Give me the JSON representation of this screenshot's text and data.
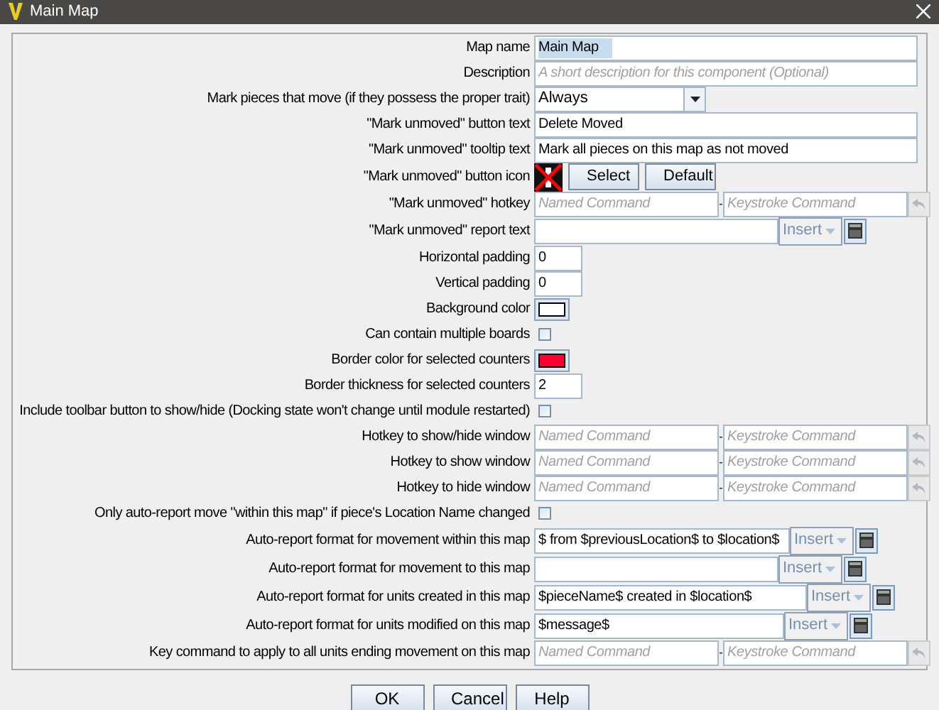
{
  "window": {
    "title": "Main Map"
  },
  "rows": [
    {
      "kind": "text",
      "label": "Map name",
      "value": "Main Map",
      "highlighted": true
    },
    {
      "kind": "text",
      "label": "Description",
      "placeholder": "A short description for this component (Optional)"
    },
    {
      "kind": "dropdown",
      "label": "Mark pieces that move (if they possess the proper trait)",
      "value": "Always"
    },
    {
      "kind": "text",
      "label": "\"Mark unmoved\" button text",
      "value": "Delete Moved"
    },
    {
      "kind": "text",
      "label": "\"Mark unmoved\" tooltip text",
      "value": "Mark all pieces on this map as not moved"
    },
    {
      "kind": "icon",
      "label": "\"Mark unmoved\" button icon",
      "buttons": [
        "Select",
        "Default"
      ]
    },
    {
      "kind": "hotkey",
      "label": "\"Mark unmoved\" hotkey",
      "named_placeholder": "Named Command",
      "separator": "-",
      "keystroke_placeholder": "Keystroke Command"
    },
    {
      "kind": "format",
      "label": "\"Mark unmoved\" report text",
      "insert": "Insert"
    },
    {
      "kind": "number",
      "label": "Horizontal padding",
      "value": "0"
    },
    {
      "kind": "number",
      "label": "Vertical padding",
      "value": "0"
    },
    {
      "kind": "color",
      "label": "Background color",
      "color": "#ffffff"
    },
    {
      "kind": "checkbox",
      "label": "Can contain multiple boards",
      "checked": false
    },
    {
      "kind": "color",
      "label": "Border color for selected counters",
      "color": "#ff0033"
    },
    {
      "kind": "number",
      "label": "Border thickness for selected counters",
      "value": "2"
    },
    {
      "kind": "checkbox",
      "label": "Include toolbar button to show/hide (Docking state won't change until module restarted)",
      "checked": false
    },
    {
      "kind": "hotkey",
      "label": "Hotkey to show/hide window",
      "named_placeholder": "Named Command",
      "separator": "-",
      "keystroke_placeholder": "Keystroke Command"
    },
    {
      "kind": "hotkey",
      "label": "Hotkey to show window",
      "named_placeholder": "Named Command",
      "separator": "-",
      "keystroke_placeholder": "Keystroke Command"
    },
    {
      "kind": "hotkey",
      "label": "Hotkey to hide window",
      "named_placeholder": "Named Command",
      "separator": "-",
      "keystroke_placeholder": "Keystroke Command"
    },
    {
      "kind": "checkbox",
      "label": "Only auto-report move \"within this map\" if piece's Location Name changed",
      "checked": false
    },
    {
      "kind": "format",
      "label": "Auto-report format for movement within this map",
      "value": "$ from $previousLocation$ to $location$",
      "insert": "Insert"
    },
    {
      "kind": "format",
      "label": "Auto-report format for movement to this map",
      "insert": "Insert"
    },
    {
      "kind": "format",
      "label": "Auto-report format for units created in this map",
      "value": "$pieceName$ created in $location$",
      "insert": "Insert"
    },
    {
      "kind": "format",
      "label": "Auto-report format for units modified on this map",
      "value": "$message$",
      "insert": "Insert"
    },
    {
      "kind": "hotkey",
      "label": "Key command to apply to all units ending movement on this map",
      "named_placeholder": "Named Command",
      "separator": "-",
      "keystroke_placeholder": "Keystroke Command"
    }
  ],
  "buttons": [
    "OK",
    "Cancel",
    "Help"
  ]
}
